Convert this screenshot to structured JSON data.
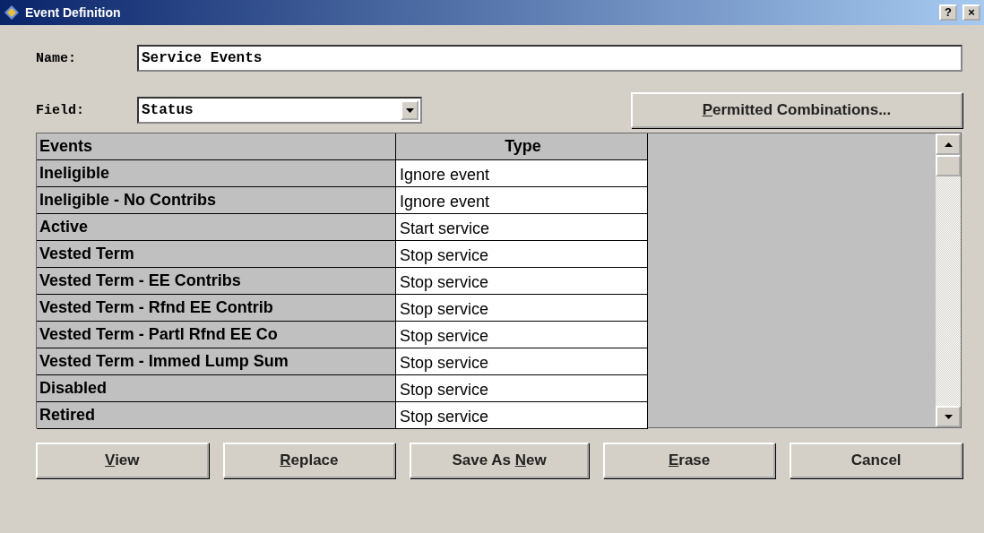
{
  "window": {
    "title": "Event Definition",
    "help": "?",
    "close": "×"
  },
  "name_field": {
    "label": "Name:",
    "value": "Service Events"
  },
  "field_select": {
    "label": "Field:",
    "value": "Status"
  },
  "permitted_button": {
    "key": "P",
    "post": "ermitted Combinations..."
  },
  "table": {
    "columns": [
      "Events",
      "Type"
    ],
    "rows": [
      {
        "event": "Ineligible",
        "type": "Ignore event"
      },
      {
        "event": "Ineligible - No Contribs",
        "type": "Ignore event"
      },
      {
        "event": "Active",
        "type": "Start service"
      },
      {
        "event": "Vested Term",
        "type": "Stop service"
      },
      {
        "event": "Vested Term - EE Contribs",
        "type": "Stop service"
      },
      {
        "event": "Vested Term - Rfnd EE Contrib",
        "type": "Stop service"
      },
      {
        "event": "Vested Term - Partl Rfnd EE Co",
        "type": "Stop service"
      },
      {
        "event": "Vested Term - Immed Lump Sum",
        "type": "Stop service"
      },
      {
        "event": "Disabled",
        "type": "Stop service"
      },
      {
        "event": "Retired",
        "type": "Stop service"
      }
    ]
  },
  "buttons": [
    {
      "key": "V",
      "post": "iew"
    },
    {
      "key": "R",
      "post": "eplace"
    },
    {
      "pre": "Save As ",
      "key": "N",
      "post": "ew"
    },
    {
      "key": "E",
      "post": "rase"
    },
    {
      "pre": "Cancel"
    }
  ]
}
